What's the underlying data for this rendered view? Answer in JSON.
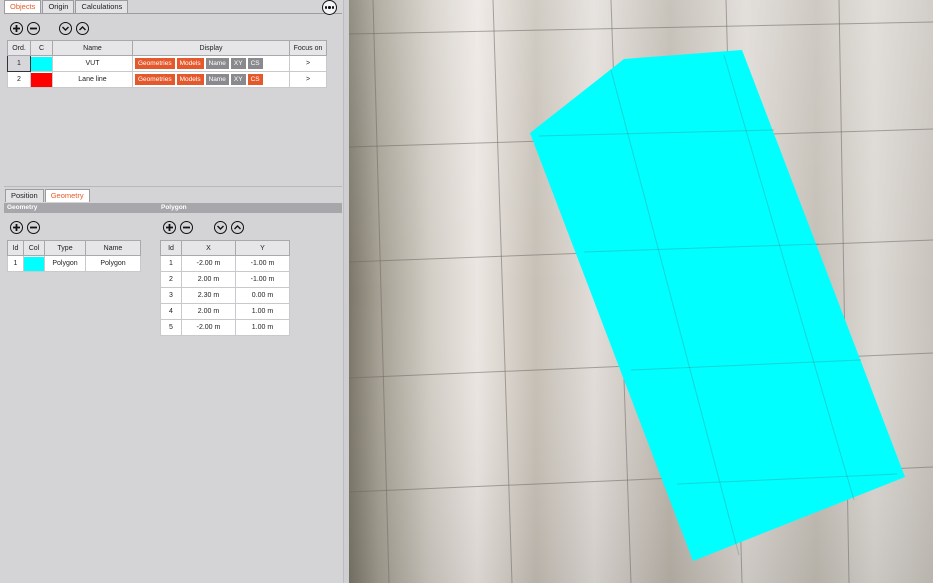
{
  "colors": {
    "accent": "#e4582c",
    "cyan": "#00ffff",
    "red": "#ff0000"
  },
  "top_tabs": [
    "Objects",
    "Origin",
    "Calculations"
  ],
  "objects_table": {
    "headers": [
      "Ord.",
      "C",
      "Name",
      "Display",
      "Focus on"
    ],
    "rows": [
      {
        "ord": "1",
        "color": "#00ffff",
        "name": "VUT",
        "geometries": "Geometries",
        "models": "Models",
        "name_btn": "Name",
        "xy": "XY",
        "cs": "CS",
        "focus": ">"
      },
      {
        "ord": "2",
        "color": "#ff0000",
        "name": "Lane line",
        "geometries": "Geometries",
        "models": "Models",
        "name_btn": "Name",
        "xy": "XY",
        "cs": "CS",
        "focus": ">"
      }
    ]
  },
  "lower_tabs": [
    "Position",
    "Geometry"
  ],
  "geometry_label": "Geometry",
  "polygon_label": "Polygon",
  "geometry_table": {
    "headers": [
      "Id",
      "Col",
      "Type",
      "Name"
    ],
    "rows": [
      {
        "id": "1",
        "color": "#00ffff",
        "type": "Polygon",
        "name": "Polygon"
      }
    ]
  },
  "polygon_table": {
    "headers": [
      "Id",
      "X",
      "Y"
    ],
    "rows": [
      {
        "id": "1",
        "x": "-2.00 m",
        "y": "-1.00 m"
      },
      {
        "id": "2",
        "x": "2.00 m",
        "y": "-1.00 m"
      },
      {
        "id": "3",
        "x": "2.30 m",
        "y": "0.00 m"
      },
      {
        "id": "4",
        "x": "2.00 m",
        "y": "1.00 m"
      },
      {
        "id": "5",
        "x": "-2.00 m",
        "y": "1.00 m"
      }
    ]
  }
}
